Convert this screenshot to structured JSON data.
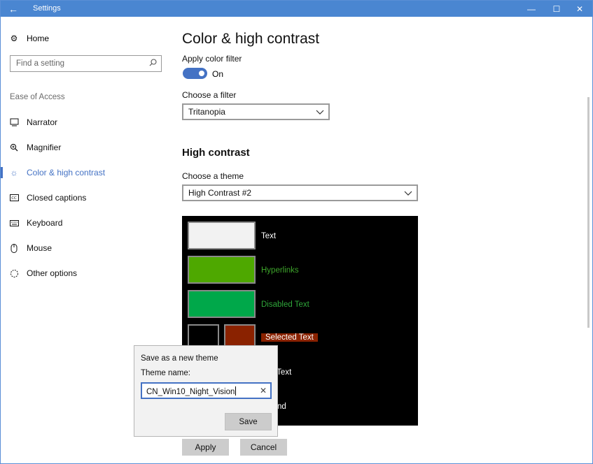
{
  "window": {
    "title": "Settings",
    "back_glyph": "←",
    "minimize_glyph": "—",
    "maximize_glyph": "☐",
    "close_glyph": "✕",
    "titlebar_color": "#4a86d1"
  },
  "sidebar": {
    "home": {
      "label": "Home",
      "icon": "gear-icon",
      "glyph": "⚙"
    },
    "search": {
      "placeholder": "Find a setting",
      "icon": "search-icon",
      "glyph": "⌕"
    },
    "section_label": "Ease of Access",
    "items": [
      {
        "label": "Narrator",
        "icon": "narrator-icon",
        "glyph": "🗔",
        "active": false
      },
      {
        "label": "Magnifier",
        "icon": "magnifier-icon",
        "glyph": "⊕",
        "active": false
      },
      {
        "label": "Color & high contrast",
        "icon": "brightness-icon",
        "glyph": "☼",
        "active": true
      },
      {
        "label": "Closed captions",
        "icon": "captions-icon",
        "glyph": "▭",
        "active": false
      },
      {
        "label": "Keyboard",
        "icon": "keyboard-icon",
        "glyph": "⌨",
        "active": false
      },
      {
        "label": "Mouse",
        "icon": "mouse-icon",
        "glyph": "▯",
        "active": false
      },
      {
        "label": "Other options",
        "icon": "other-options-icon",
        "glyph": "◌",
        "active": false
      }
    ],
    "accent_color": "#4472c4"
  },
  "main": {
    "title": "Color & high contrast",
    "color_filter": {
      "label": "Apply color filter",
      "state": "On",
      "on": true
    },
    "filter": {
      "label": "Choose a filter",
      "value": "Tritanopia"
    },
    "high_contrast": {
      "heading": "High contrast",
      "theme_label": "Choose a theme",
      "theme_value": "High Contrast #2"
    },
    "preview": {
      "background": "#000000",
      "items": [
        {
          "label": "Text",
          "color": "#f2f2f2",
          "label_color": "#ffffff"
        },
        {
          "label": "Hyperlinks",
          "color": "#4ea800",
          "label_color": "#3ea52b"
        },
        {
          "label": "Disabled Text",
          "color": "#00a84a",
          "label_color": "#2fa63a"
        },
        {
          "label": "Selected Text",
          "colors": [
            "#000000",
            "#8a2200"
          ],
          "label_color": "#ffffff",
          "label_bg": "#8a2200"
        },
        {
          "label": "Button Text",
          "visible_label": "tton Text",
          "label_color": "#ffffff"
        },
        {
          "label": "Background",
          "visible_label": "ground",
          "label_color": "#ffffff"
        }
      ]
    },
    "buttons": {
      "apply": "Apply",
      "cancel": "Cancel"
    }
  },
  "dialog": {
    "title": "Save as a new theme",
    "name_label": "Theme name:",
    "name_value": "CN_Win10_Night_Vision",
    "clear_glyph": "✕",
    "save_label": "Save"
  }
}
